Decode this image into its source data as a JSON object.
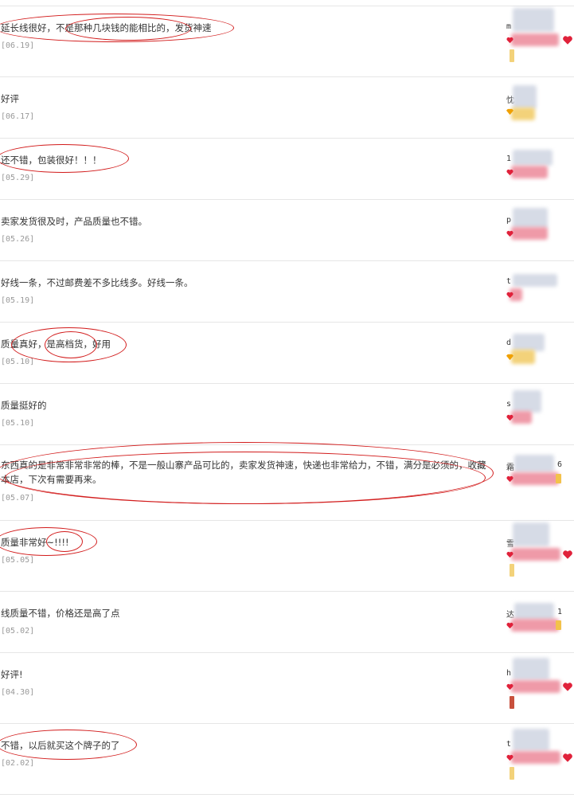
{
  "reviews": [
    {
      "comment": "延长线很好，不是那种几块钱的能相比的，发货神速",
      "date": "[06.19]",
      "user": "m",
      "user_suffix": ""
    },
    {
      "comment": "好评",
      "date": "[06.17]",
      "user": "忱",
      "user_suffix": ""
    },
    {
      "comment": "还不错，包装很好！！！",
      "date": "[05.29]",
      "user": "1",
      "user_suffix": ""
    },
    {
      "comment": "卖家发货很及时，产品质量也不错。",
      "date": "[05.26]",
      "user": "p",
      "user_suffix": ""
    },
    {
      "comment": "好线一条，不过邮费差不多比线多。好线一条。",
      "date": "[05.19]",
      "user": "t",
      "user_suffix": ""
    },
    {
      "comment": "质量真好，是高档货，好用",
      "date": "[05.10]",
      "user": "d",
      "user_suffix": ""
    },
    {
      "comment": "质量挺好的",
      "date": "[05.10]",
      "user": "s",
      "user_suffix": ""
    },
    {
      "comment": "东西真的是非常非常非常的棒，不是一般山寨产品可比的，卖家发货神速，快递也非常给力，不错，满分是必须的，收藏本店，下次有需要再来。",
      "date": "[05.07]",
      "user": "霜",
      "user_suffix": "6"
    },
    {
      "comment": "质量非常好~!!!!",
      "date": "[05.05]",
      "user": "雪",
      "user_suffix": ""
    },
    {
      "comment": "线质量不错，价格还是高了点",
      "date": "[05.02]",
      "user": "达",
      "user_suffix": "1"
    },
    {
      "comment": "好评!",
      "date": "[04.30]",
      "user": "h",
      "user_suffix": ""
    },
    {
      "comment": "不错，以后就买这个牌子的了",
      "date": "[02.02]",
      "user": "t",
      "user_suffix": ""
    }
  ],
  "colors": {
    "annotation_ring": "#d21b1b",
    "heart": "#e0213a",
    "date": "#999999"
  }
}
